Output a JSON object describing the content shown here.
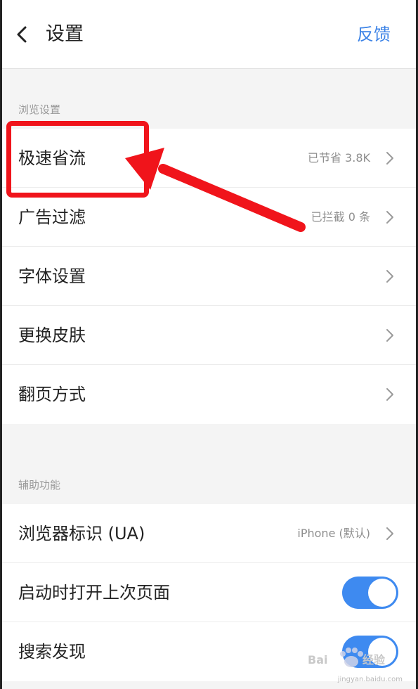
{
  "header": {
    "title": "设置",
    "feedback_label": "反馈"
  },
  "sections": [
    {
      "label": "浏览设置",
      "rows": [
        {
          "label": "极速省流",
          "value": "已节省 3.8K",
          "control": "chevron"
        },
        {
          "label": "广告过滤",
          "value": "已拦截 0 条",
          "control": "chevron"
        },
        {
          "label": "字体设置",
          "value": "",
          "control": "chevron"
        },
        {
          "label": "更换皮肤",
          "value": "",
          "control": "chevron"
        },
        {
          "label": "翻页方式",
          "value": "",
          "control": "chevron"
        }
      ]
    },
    {
      "label": "辅助功能",
      "rows": [
        {
          "label": "浏览器标识 (UA)",
          "value": "iPhone (默认)",
          "control": "chevron"
        },
        {
          "label": "启动时打开上次页面",
          "value": "",
          "control": "toggle",
          "on": true
        },
        {
          "label": "搜索发现",
          "value": "",
          "control": "toggle",
          "on": true
        }
      ]
    }
  ],
  "watermark": {
    "logo_text": "Bai du 经验",
    "url_text": "jingyan.baidu.com"
  },
  "colors": {
    "accent": "#3b82e6",
    "toggle_on": "#3e8af0",
    "annotation": "#f0141b"
  },
  "icons": {
    "back": "chevron-left-icon",
    "row_arrow": "chevron-right-icon"
  }
}
